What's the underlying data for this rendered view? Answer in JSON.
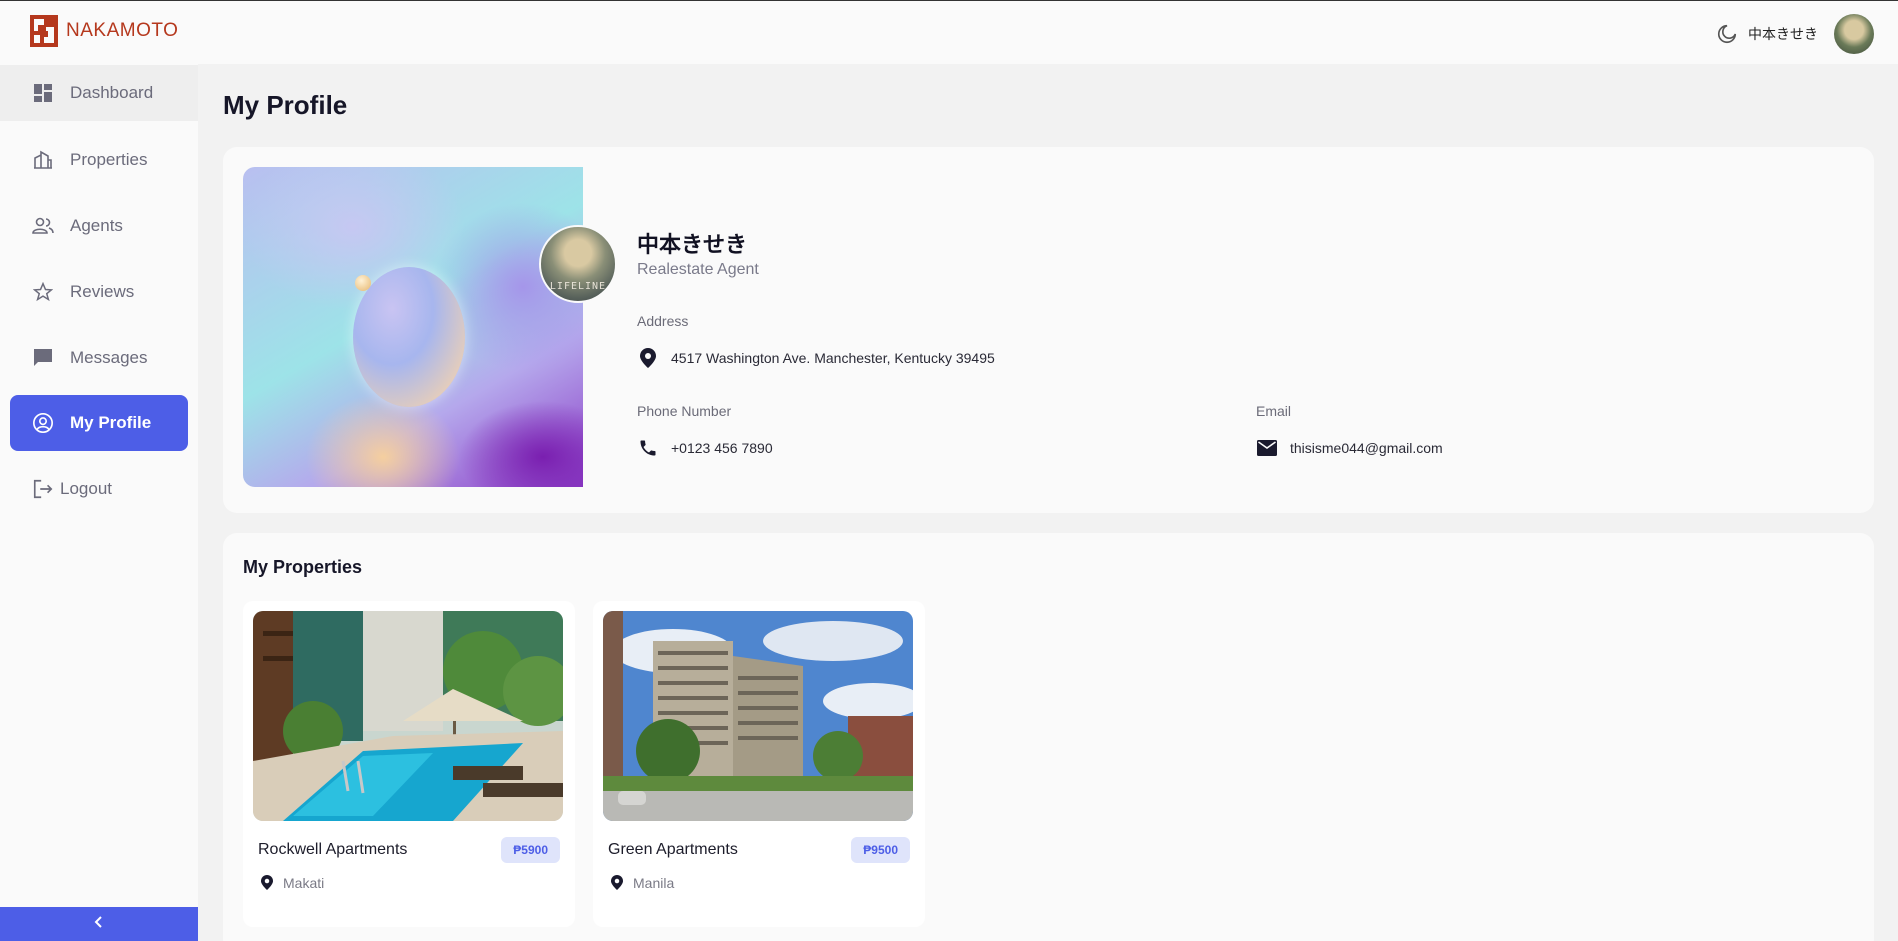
{
  "brand": {
    "name": "NAKAMOTO",
    "color": "#b5381d"
  },
  "header": {
    "username": "中本きせき",
    "theme_icon": "moon-icon"
  },
  "sidebar": {
    "items": [
      {
        "label": "Dashboard",
        "icon": "dashboard-icon"
      },
      {
        "label": "Properties",
        "icon": "building-icon"
      },
      {
        "label": "Agents",
        "icon": "people-icon"
      },
      {
        "label": "Reviews",
        "icon": "star-icon"
      },
      {
        "label": "Messages",
        "icon": "chat-icon"
      },
      {
        "label": "My Profile",
        "icon": "user-circle-icon",
        "active": true
      },
      {
        "label": "Logout",
        "icon": "logout-icon"
      }
    ],
    "collapse_icon": "chevron-left-icon",
    "accent": "#4d5ee7"
  },
  "page": {
    "title": "My Profile"
  },
  "profile": {
    "name": "中本きせき",
    "role": "Realestate Agent",
    "avatar_caption": "LIFELINE",
    "address_label": "Address",
    "address": "4517 Washington Ave. Manchester, Kentucky 39495",
    "phone_label": "Phone Number",
    "phone": "+0123 456 7890",
    "email_label": "Email",
    "email": "thisisme044@gmail.com"
  },
  "properties": {
    "title": "My Properties",
    "items": [
      {
        "name": "Rockwell Apartments",
        "price": "₱5900",
        "location": "Makati"
      },
      {
        "name": "Green Apartments",
        "price": "₱9500",
        "location": "Manila"
      }
    ]
  }
}
